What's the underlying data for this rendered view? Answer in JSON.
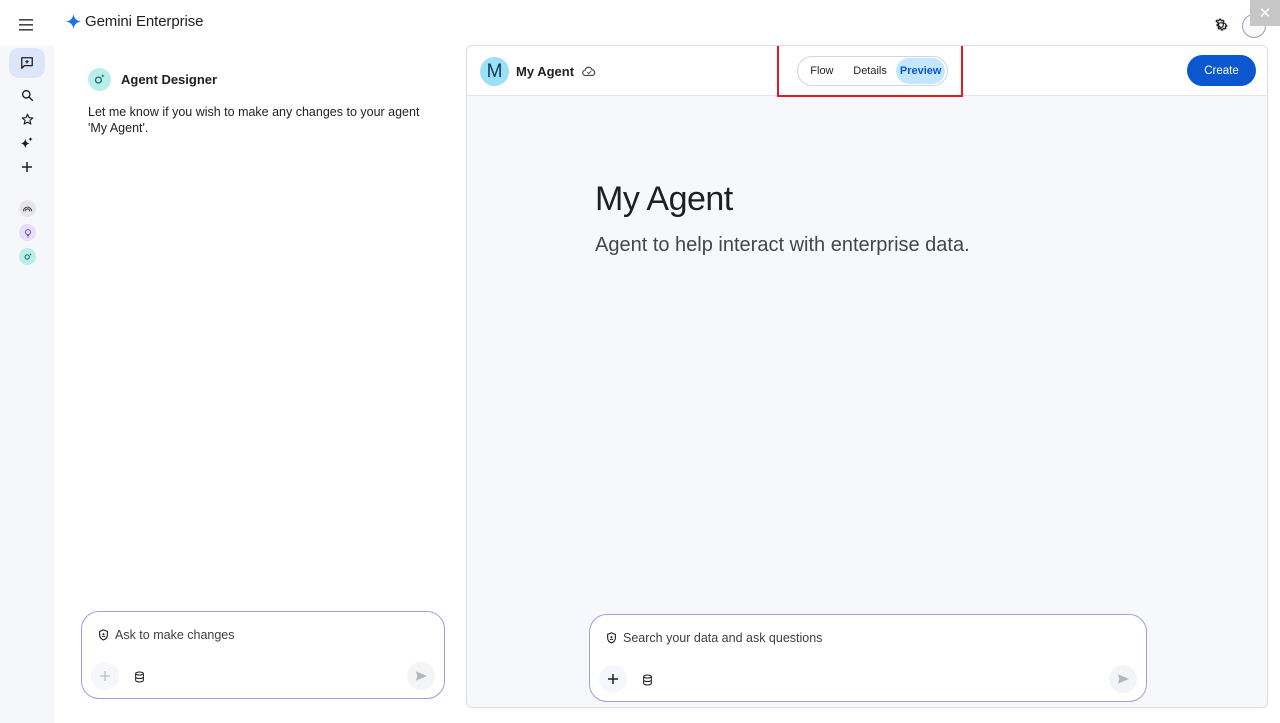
{
  "app": {
    "brand": "Gemini Enterprise",
    "accent_color": "#0b57d0",
    "close_glyph": "✕"
  },
  "rail": {
    "items": [
      {
        "icon": "new-chat-icon",
        "active": true
      },
      {
        "icon": "search-icon"
      },
      {
        "icon": "star-icon"
      },
      {
        "icon": "sparkle-icon"
      },
      {
        "icon": "plus-icon"
      }
    ],
    "agents": [
      {
        "icon": "rainbow-icon",
        "color": "#e6e6e6"
      },
      {
        "icon": "lightbulb-icon",
        "color": "#e7defa"
      },
      {
        "icon": "agent-designer-icon",
        "color": "#b9eeea"
      }
    ]
  },
  "designer": {
    "title": "Agent Designer",
    "message": "Let me know if you wish to make any changes to your agent 'My Agent'.",
    "composer_placeholder": "Ask to make changes"
  },
  "preview": {
    "avatar_letter": "M",
    "agent_name": "My Agent",
    "tabs": [
      {
        "label": "Flow",
        "selected": false
      },
      {
        "label": "Details",
        "selected": false
      },
      {
        "label": "Preview",
        "selected": true
      }
    ],
    "create_label": "Create",
    "heading": "My Agent",
    "description": "Agent to help interact with enterprise data.",
    "composer_placeholder": "Search your data and ask questions"
  }
}
